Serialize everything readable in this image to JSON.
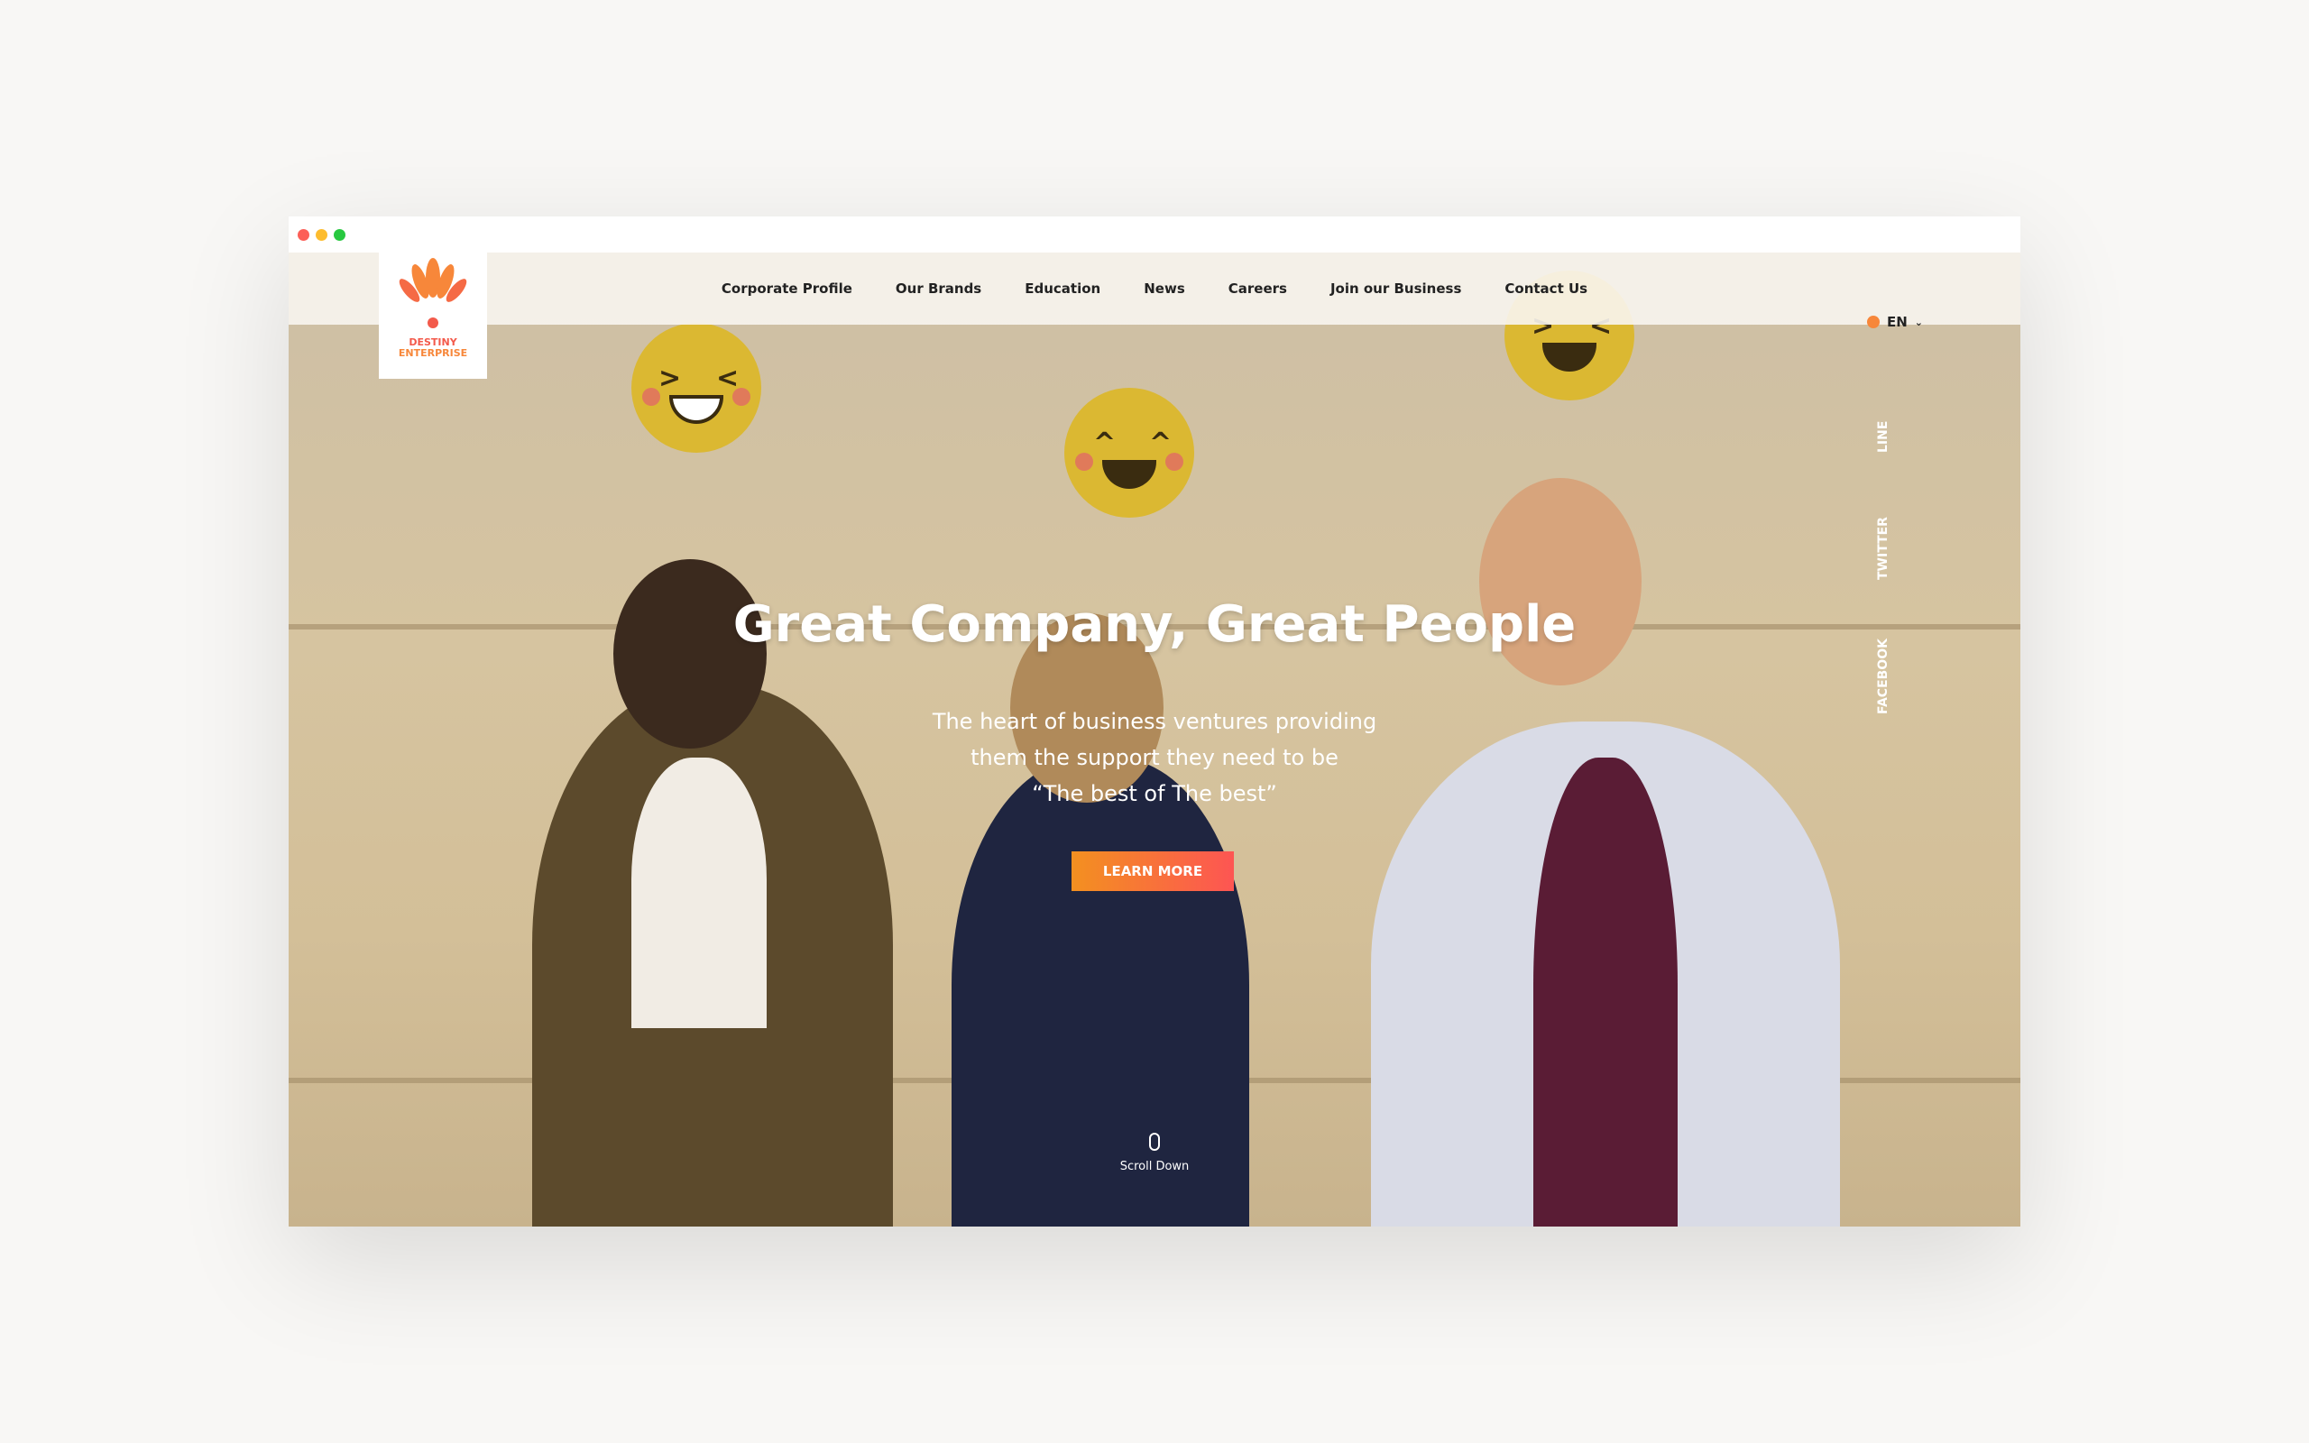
{
  "window": {
    "controls": [
      "close",
      "minimize",
      "maximize"
    ]
  },
  "logo": {
    "line1": "DESTINY",
    "line2": "ENTERPRISE"
  },
  "nav": {
    "items": [
      "Corporate Profile",
      "Our Brands",
      "Education",
      "News",
      "Careers",
      "Join our Business",
      "Contact Us"
    ]
  },
  "language": {
    "icon": "globe-icon",
    "selected": "EN"
  },
  "hero": {
    "headline": "Great Company, Great People",
    "subtitle_lines": [
      "The heart of business ventures providing",
      "them the support they need to be",
      "“The best of The best”"
    ],
    "cta": "LEARN MORE",
    "scroll_label": "Scroll Down"
  },
  "social": [
    "LINE",
    "TWITTER",
    "FACEBOOK"
  ],
  "colors": {
    "accent_start": "#f39020",
    "accent_end": "#fd5553",
    "logo": "#f7873a"
  }
}
